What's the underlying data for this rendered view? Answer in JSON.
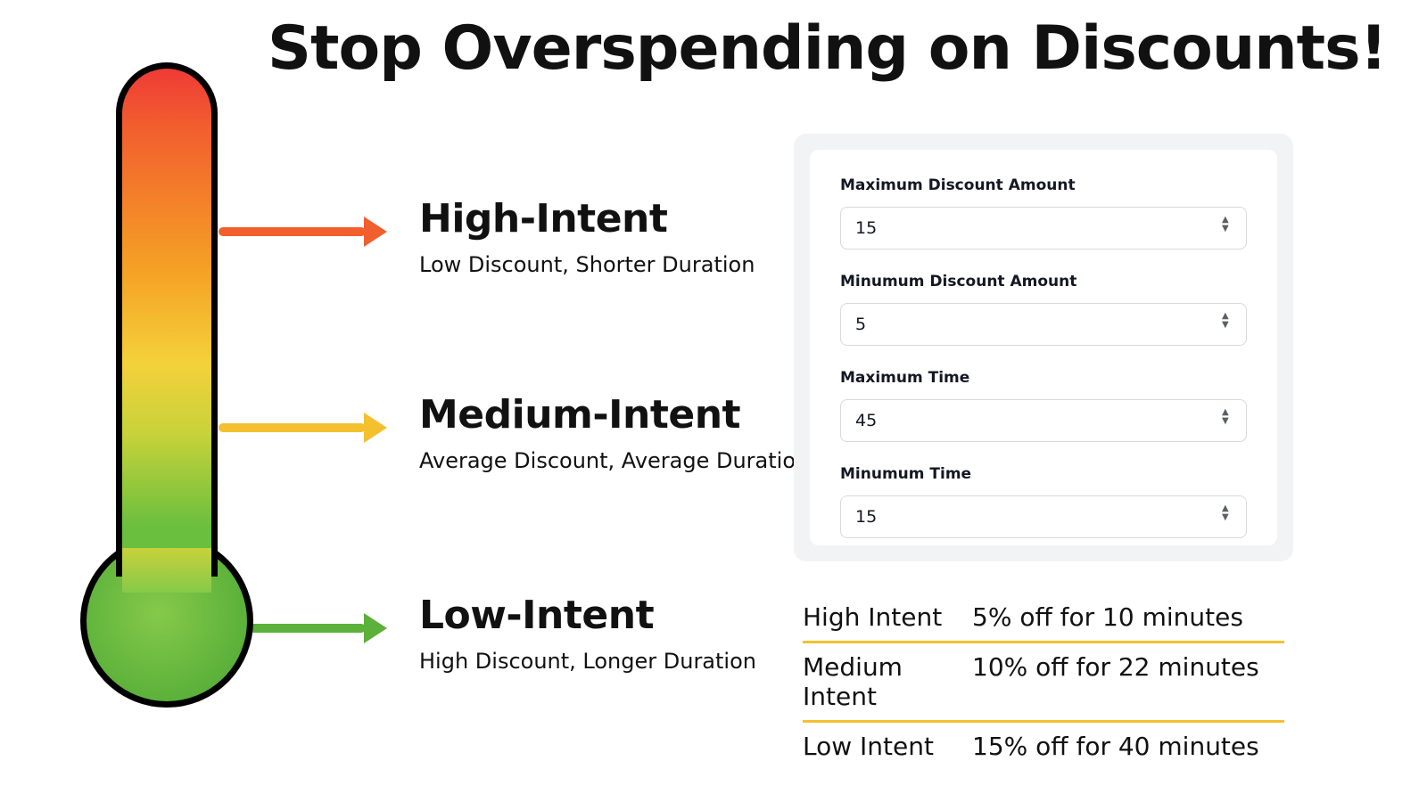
{
  "title": "Stop Overspending on Discounts!",
  "callouts": [
    {
      "heading": "High-Intent",
      "sub": "Low Discount, Shorter Duration"
    },
    {
      "heading": "Medium-Intent",
      "sub": "Average Discount, Average Duration"
    },
    {
      "heading": "Low-Intent",
      "sub": "High Discount, Longer Duration"
    }
  ],
  "form": {
    "fields": [
      {
        "label": "Maximum Discount Amount",
        "value": "15"
      },
      {
        "label": "Minumum Discount Amount",
        "value": "5"
      },
      {
        "label": "Maximum Time",
        "value": "45"
      },
      {
        "label": "Minumum Time",
        "value": "15"
      }
    ]
  },
  "results": [
    {
      "label": "High Intent",
      "value": "5% off for 10 minutes"
    },
    {
      "label": "Medium Intent",
      "value": "10% off for 22 minutes"
    },
    {
      "label": "Low Intent",
      "value": "15% off for 40 minutes"
    }
  ],
  "colors": {
    "red": "#f25f2e",
    "yellow": "#f4c02e",
    "green": "#5bb13a"
  }
}
